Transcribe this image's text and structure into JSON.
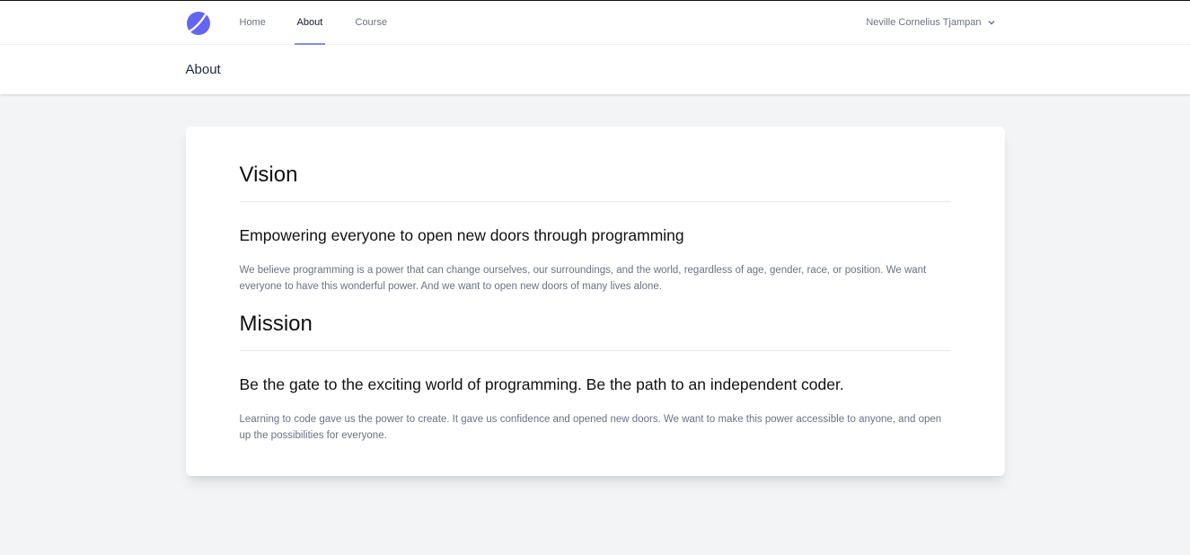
{
  "colors": {
    "accent": "#818cf8",
    "logo": "#6366f1",
    "background": "#f3f4f6"
  },
  "nav": {
    "logo_icon": "crescent-moon-logo",
    "links": [
      {
        "label": "Home",
        "active": false
      },
      {
        "label": "About",
        "active": true
      },
      {
        "label": "Course",
        "active": false
      }
    ],
    "user_name": "Neville Cornelius Tjampan",
    "user_menu_icon": "chevron-down-icon"
  },
  "header": {
    "title": "About"
  },
  "vision": {
    "title": "Vision",
    "subtitle": "Empowering everyone to open new doors through programming",
    "body": "We believe programming is a power that can change ourselves, our surroundings, and the world, regardless of age, gender, race, or position. We want everyone to have this wonderful power. And we want to open new doors of many lives alone."
  },
  "mission": {
    "title": "Mission",
    "subtitle": "Be the gate to the exciting world of programming. Be the path to an independent coder.",
    "body": "Learning to code gave us the power to create. It gave us confidence and opened new doors. We want to make this power accessible to anyone, and open up the possibilities for everyone."
  }
}
